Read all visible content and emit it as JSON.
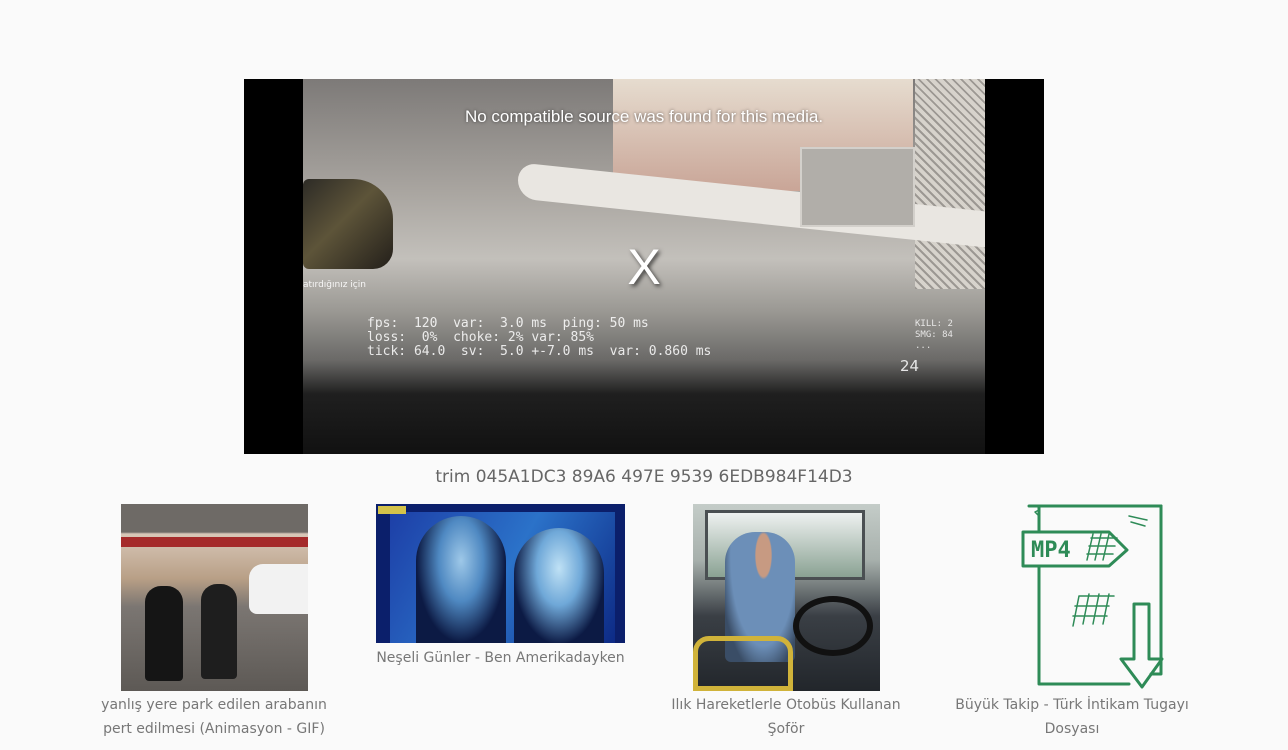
{
  "player": {
    "error_message": "No compatible source was found for this media.",
    "close_glyph": "X",
    "hud_left": "atırdığınız için",
    "hud_stats": "fps:  120  var:  3.0 ms  ping: 50 ms\nloss:  0%  choke: 2% var: 85%\ntick: 64.0  sv:  5.0 +-7.0 ms  var: 0.860 ms",
    "hud_right": "KILL: 2\nSMG: 84\n...",
    "hud_ammo": "24"
  },
  "video": {
    "title": "trim 045A1DC3 89A6 497E 9539 6EDB984F14D3"
  },
  "related": [
    {
      "caption": "yanlış yere park edilen arabanın pert edilmesi (Animasyon - GIF)",
      "line1": "yanlış yere park edilen arabanın",
      "line2": "pert edilmesi (Animasyon - GIF)"
    },
    {
      "caption": "Neşeli Günler - Ben Amerikadayken"
    },
    {
      "caption": "Ilık Hareketlerle Otobüs Kullanan Şoför",
      "line1": "Ilık Hareketlerle Otobüs Kullanan",
      "line2": "Şoför"
    },
    {
      "caption": "Büyük Takip - Türk İntikam Tugayı Dosyası",
      "line1": "Büyük Takip - Türk İntikam Tugayı",
      "line2": "Dosyası",
      "icon_label": "MP4"
    }
  ],
  "colors": {
    "page_bg": "#fafafa",
    "player_bg": "#000000",
    "text_muted": "#666666",
    "mp4_icon": "#2e8b57"
  }
}
